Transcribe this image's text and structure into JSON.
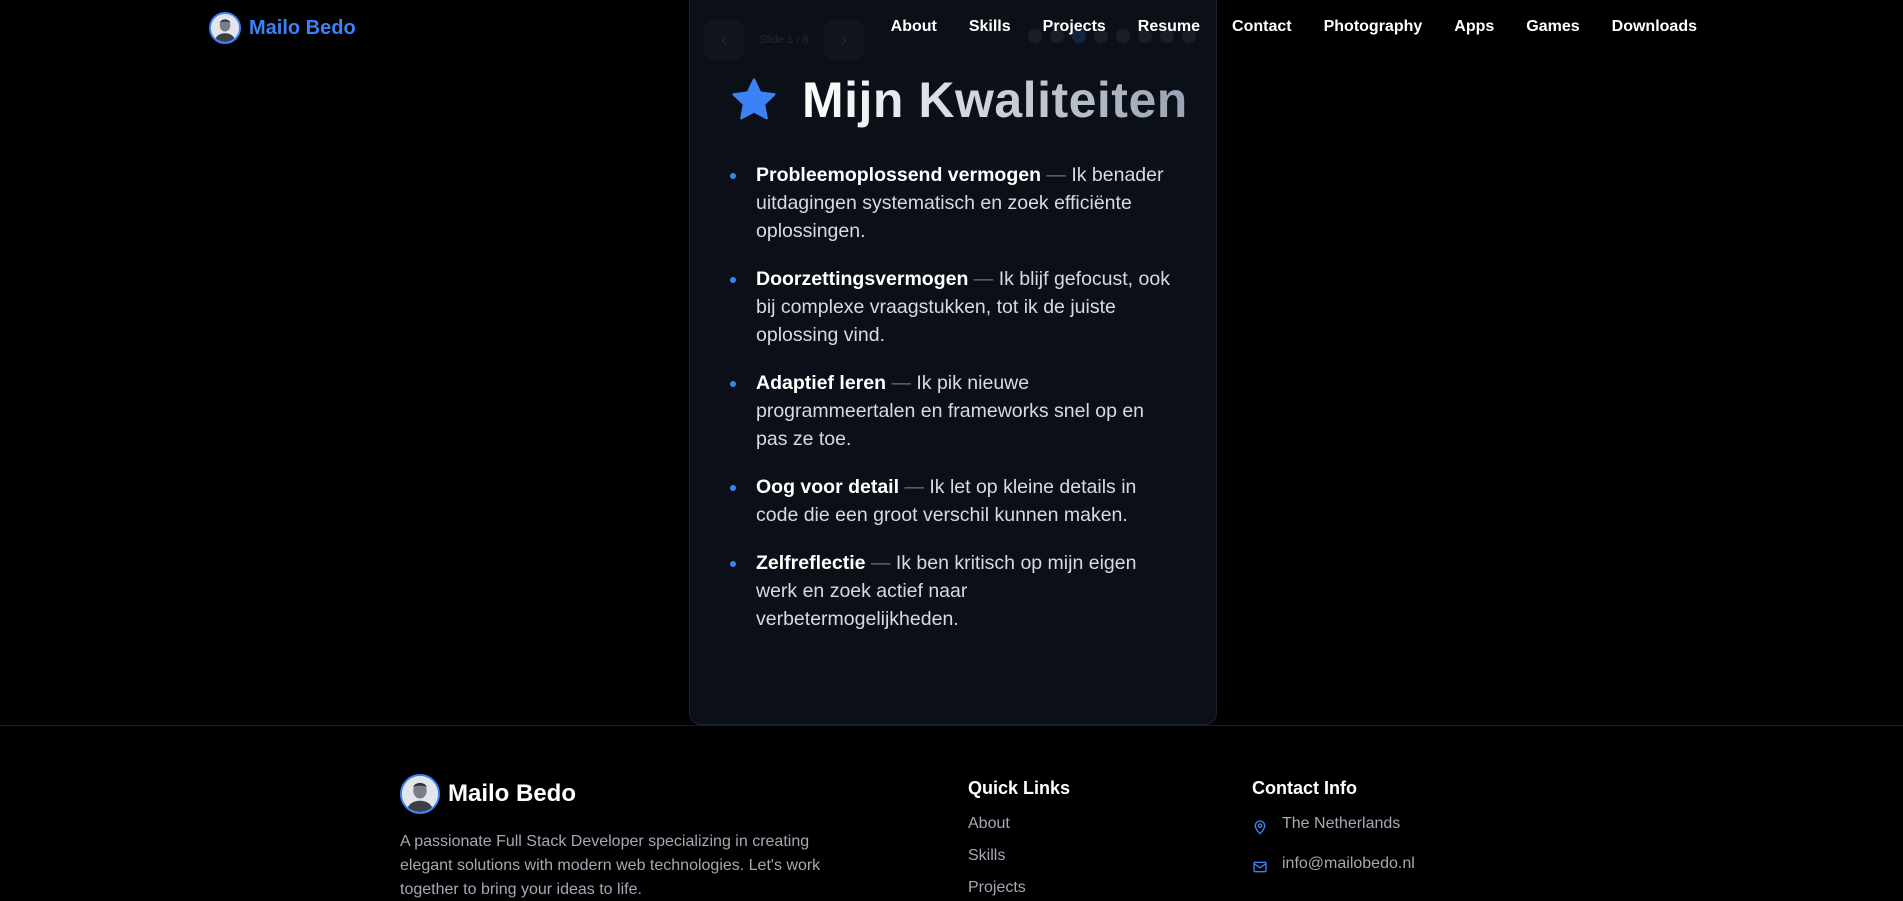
{
  "nav": {
    "brand": "Mailo Bedo",
    "links": [
      "About",
      "Skills",
      "Projects",
      "Resume",
      "Contact",
      "Photography",
      "Apps",
      "Games",
      "Downloads"
    ]
  },
  "card": {
    "pager_text": "Slide 1 / 8",
    "title": "Mijn Kwaliteiten",
    "qualities": [
      {
        "term": "Probleemoplossend vermogen",
        "desc": "Ik benader uitdagingen systematisch en zoek efficiënte oplossingen."
      },
      {
        "term": "Doorzettingsvermogen",
        "desc": "Ik blijf gefocust, ook bij complexe vraagstukken, tot ik de juiste oplossing vind."
      },
      {
        "term": "Adaptief leren",
        "desc": "Ik pik nieuwe programmeertalen en frameworks snel op en pas ze toe."
      },
      {
        "term": "Oog voor detail",
        "desc": "Ik let op kleine details in code die een groot verschil kunnen maken."
      },
      {
        "term": "Zelfreflectie",
        "desc": "Ik ben kritisch op mijn eigen werk en zoek actief naar verbetermogelijkheden."
      }
    ]
  },
  "footer": {
    "brand": "Mailo Bedo",
    "description": "A passionate Full Stack Developer specializing in creating elegant solutions with modern web technologies. Let's work together to bring your ideas to life.",
    "quick_links_title": "Quick Links",
    "quick_links": [
      "About",
      "Skills",
      "Projects"
    ],
    "contact_title": "Contact Info",
    "contact_location": "The Netherlands",
    "contact_email": "info@mailobedo.nl"
  },
  "colors": {
    "accent": "#3b82f6",
    "background": "#000000",
    "card": "#0b0f17"
  }
}
